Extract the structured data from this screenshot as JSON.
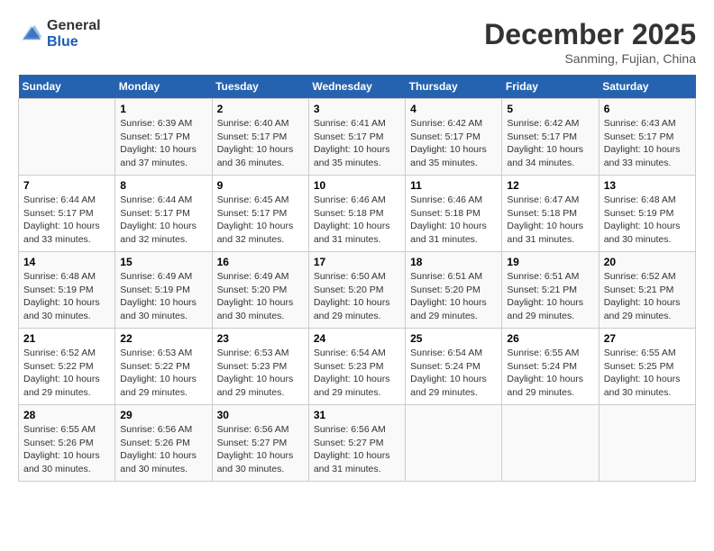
{
  "header": {
    "logo_general": "General",
    "logo_blue": "Blue",
    "month_title": "December 2025",
    "location": "Sanming, Fujian, China"
  },
  "days_of_week": [
    "Sunday",
    "Monday",
    "Tuesday",
    "Wednesday",
    "Thursday",
    "Friday",
    "Saturday"
  ],
  "weeks": [
    [
      {
        "day": "",
        "info": ""
      },
      {
        "day": "1",
        "info": "Sunrise: 6:39 AM\nSunset: 5:17 PM\nDaylight: 10 hours\nand 37 minutes."
      },
      {
        "day": "2",
        "info": "Sunrise: 6:40 AM\nSunset: 5:17 PM\nDaylight: 10 hours\nand 36 minutes."
      },
      {
        "day": "3",
        "info": "Sunrise: 6:41 AM\nSunset: 5:17 PM\nDaylight: 10 hours\nand 35 minutes."
      },
      {
        "day": "4",
        "info": "Sunrise: 6:42 AM\nSunset: 5:17 PM\nDaylight: 10 hours\nand 35 minutes."
      },
      {
        "day": "5",
        "info": "Sunrise: 6:42 AM\nSunset: 5:17 PM\nDaylight: 10 hours\nand 34 minutes."
      },
      {
        "day": "6",
        "info": "Sunrise: 6:43 AM\nSunset: 5:17 PM\nDaylight: 10 hours\nand 33 minutes."
      }
    ],
    [
      {
        "day": "7",
        "info": "Sunrise: 6:44 AM\nSunset: 5:17 PM\nDaylight: 10 hours\nand 33 minutes."
      },
      {
        "day": "8",
        "info": "Sunrise: 6:44 AM\nSunset: 5:17 PM\nDaylight: 10 hours\nand 32 minutes."
      },
      {
        "day": "9",
        "info": "Sunrise: 6:45 AM\nSunset: 5:17 PM\nDaylight: 10 hours\nand 32 minutes."
      },
      {
        "day": "10",
        "info": "Sunrise: 6:46 AM\nSunset: 5:18 PM\nDaylight: 10 hours\nand 31 minutes."
      },
      {
        "day": "11",
        "info": "Sunrise: 6:46 AM\nSunset: 5:18 PM\nDaylight: 10 hours\nand 31 minutes."
      },
      {
        "day": "12",
        "info": "Sunrise: 6:47 AM\nSunset: 5:18 PM\nDaylight: 10 hours\nand 31 minutes."
      },
      {
        "day": "13",
        "info": "Sunrise: 6:48 AM\nSunset: 5:19 PM\nDaylight: 10 hours\nand 30 minutes."
      }
    ],
    [
      {
        "day": "14",
        "info": "Sunrise: 6:48 AM\nSunset: 5:19 PM\nDaylight: 10 hours\nand 30 minutes."
      },
      {
        "day": "15",
        "info": "Sunrise: 6:49 AM\nSunset: 5:19 PM\nDaylight: 10 hours\nand 30 minutes."
      },
      {
        "day": "16",
        "info": "Sunrise: 6:49 AM\nSunset: 5:20 PM\nDaylight: 10 hours\nand 30 minutes."
      },
      {
        "day": "17",
        "info": "Sunrise: 6:50 AM\nSunset: 5:20 PM\nDaylight: 10 hours\nand 29 minutes."
      },
      {
        "day": "18",
        "info": "Sunrise: 6:51 AM\nSunset: 5:20 PM\nDaylight: 10 hours\nand 29 minutes."
      },
      {
        "day": "19",
        "info": "Sunrise: 6:51 AM\nSunset: 5:21 PM\nDaylight: 10 hours\nand 29 minutes."
      },
      {
        "day": "20",
        "info": "Sunrise: 6:52 AM\nSunset: 5:21 PM\nDaylight: 10 hours\nand 29 minutes."
      }
    ],
    [
      {
        "day": "21",
        "info": "Sunrise: 6:52 AM\nSunset: 5:22 PM\nDaylight: 10 hours\nand 29 minutes."
      },
      {
        "day": "22",
        "info": "Sunrise: 6:53 AM\nSunset: 5:22 PM\nDaylight: 10 hours\nand 29 minutes."
      },
      {
        "day": "23",
        "info": "Sunrise: 6:53 AM\nSunset: 5:23 PM\nDaylight: 10 hours\nand 29 minutes."
      },
      {
        "day": "24",
        "info": "Sunrise: 6:54 AM\nSunset: 5:23 PM\nDaylight: 10 hours\nand 29 minutes."
      },
      {
        "day": "25",
        "info": "Sunrise: 6:54 AM\nSunset: 5:24 PM\nDaylight: 10 hours\nand 29 minutes."
      },
      {
        "day": "26",
        "info": "Sunrise: 6:55 AM\nSunset: 5:24 PM\nDaylight: 10 hours\nand 29 minutes."
      },
      {
        "day": "27",
        "info": "Sunrise: 6:55 AM\nSunset: 5:25 PM\nDaylight: 10 hours\nand 30 minutes."
      }
    ],
    [
      {
        "day": "28",
        "info": "Sunrise: 6:55 AM\nSunset: 5:26 PM\nDaylight: 10 hours\nand 30 minutes."
      },
      {
        "day": "29",
        "info": "Sunrise: 6:56 AM\nSunset: 5:26 PM\nDaylight: 10 hours\nand 30 minutes."
      },
      {
        "day": "30",
        "info": "Sunrise: 6:56 AM\nSunset: 5:27 PM\nDaylight: 10 hours\nand 30 minutes."
      },
      {
        "day": "31",
        "info": "Sunrise: 6:56 AM\nSunset: 5:27 PM\nDaylight: 10 hours\nand 31 minutes."
      },
      {
        "day": "",
        "info": ""
      },
      {
        "day": "",
        "info": ""
      },
      {
        "day": "",
        "info": ""
      }
    ]
  ]
}
